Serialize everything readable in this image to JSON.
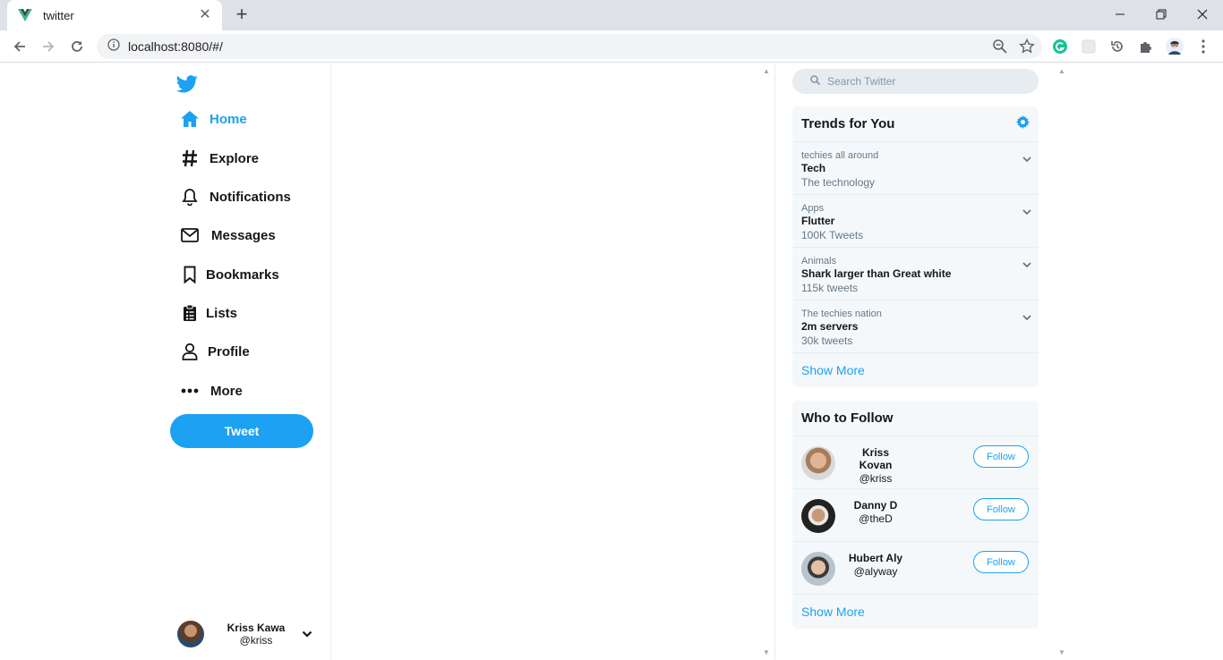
{
  "browser": {
    "tab_title": "twitter",
    "url": "localhost:8080/#/"
  },
  "sidebar": {
    "items": [
      {
        "label": "Home",
        "icon": "home-icon",
        "active": true
      },
      {
        "label": "Explore",
        "icon": "hash-icon"
      },
      {
        "label": "Notifications",
        "icon": "bell-icon"
      },
      {
        "label": "Messages",
        "icon": "mail-icon"
      },
      {
        "label": "Bookmarks",
        "icon": "bookmark-icon"
      },
      {
        "label": "Lists",
        "icon": "clipboard-icon"
      },
      {
        "label": "Profile",
        "icon": "user-icon"
      },
      {
        "label": "More",
        "icon": "dots-icon"
      }
    ],
    "tweet_label": "Tweet",
    "user": {
      "name": "Kriss Kawa",
      "handle": "@kriss"
    }
  },
  "search": {
    "placeholder": "Search Twitter"
  },
  "trends": {
    "title": "Trends for You",
    "items": [
      {
        "category": "techies all around",
        "topic": "Tech",
        "count": "The technology"
      },
      {
        "category": "Apps",
        "topic": "Flutter",
        "count": "100K Tweets"
      },
      {
        "category": "Animals",
        "topic": "Shark larger than Great white",
        "count": "115k tweets"
      },
      {
        "category": "The techies nation",
        "topic": "2m servers",
        "count": "30k tweets"
      }
    ],
    "show_more": "Show More"
  },
  "who_to_follow": {
    "title": "Who to Follow",
    "items": [
      {
        "name": "Kriss Kovan",
        "handle": "@kriss",
        "button": "Follow"
      },
      {
        "name": "Danny D",
        "handle": "@theD",
        "button": "Follow"
      },
      {
        "name": "Hubert Aly",
        "handle": "@alyway",
        "button": "Follow"
      }
    ],
    "show_more": "Show More"
  },
  "colors": {
    "accent": "#1da1f2",
    "panel_bg": "#f5f8fa",
    "border": "#e6ecf0"
  }
}
